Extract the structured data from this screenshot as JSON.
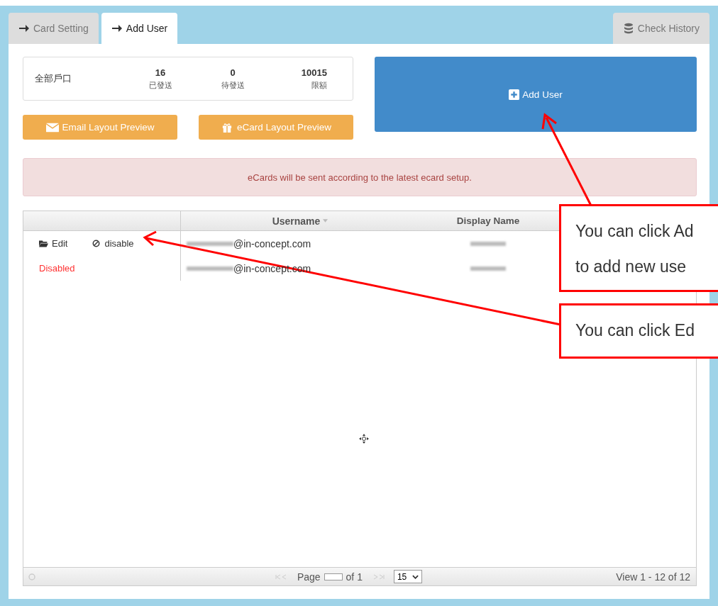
{
  "tabs": [
    {
      "label": "Card Setting",
      "selected": false
    },
    {
      "label": "Add User",
      "selected": true
    }
  ],
  "right_tab": {
    "label": "Check History"
  },
  "stats": {
    "label": "全部戶口",
    "items": [
      {
        "value": "16",
        "label": "已發送"
      },
      {
        "value": "0",
        "label": "待發送"
      },
      {
        "value": "10015",
        "label": "限額"
      }
    ]
  },
  "preview_buttons": [
    {
      "kind": "email",
      "label": "Email Layout Preview"
    },
    {
      "kind": "ecard",
      "label": "eCard Layout Preview"
    }
  ],
  "add_user_button": {
    "label": "Add User"
  },
  "alert": "eCards will be sent according to the latest ecard setup.",
  "table": {
    "columns": [
      {
        "label": "Username",
        "sorted": true
      },
      {
        "label": "Display Name",
        "sorted": false
      }
    ],
    "rows": [
      {
        "kind": "active",
        "actions": [
          "Edit",
          "disable"
        ],
        "username": "@in-concept.com"
      },
      {
        "kind": "disabled",
        "status": "Disabled",
        "username": "@in-concept.com"
      }
    ]
  },
  "pager": {
    "page_label": "Page",
    "of_label": "of 1",
    "page_size": "15",
    "view": "View 1 - 12 of 12"
  },
  "callouts": [
    {
      "lines": [
        "You can click Ad",
        "to add new use"
      ]
    },
    {
      "lines": [
        "You can click Ed"
      ]
    }
  ]
}
